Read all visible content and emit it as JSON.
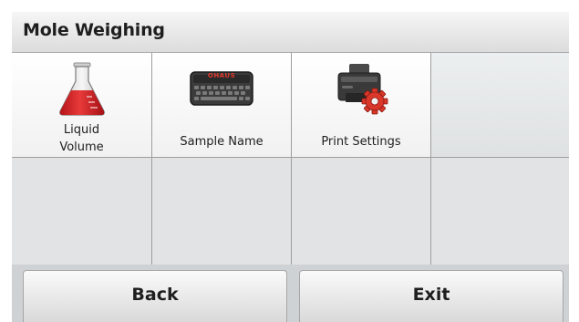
{
  "header": {
    "title": "Mole Weighing"
  },
  "menu": {
    "items": [
      {
        "label_line1": "Liquid",
        "label_line2": "Volume",
        "icon": "flask-icon"
      },
      {
        "label": "Sample Name",
        "icon": "keyboard-icon"
      },
      {
        "label": "Print Settings",
        "icon": "printer-settings-icon"
      }
    ]
  },
  "keyboard_brand": "OHAUS",
  "footer": {
    "back_label": "Back",
    "exit_label": "Exit"
  },
  "colors": {
    "flask_liquid": "#d21f25",
    "gear": "#d9372a"
  }
}
